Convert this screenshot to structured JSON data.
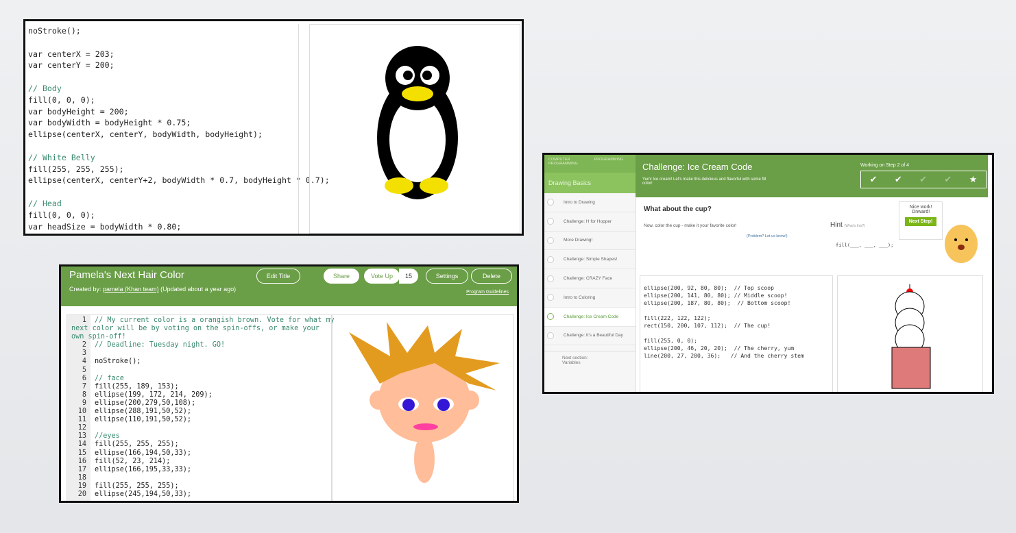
{
  "penguin_code": {
    "lines": [
      "noStroke();",
      "",
      "var centerX = 203;",
      "var centerY = 200;",
      "",
      "// Body",
      "fill(0, 0, 0);",
      "var bodyHeight = 200;",
      "var bodyWidth = bodyHeight * 0.75;",
      "ellipse(centerX, centerY, bodyWidth, bodyHeight);",
      "",
      "// White Belly",
      "fill(255, 255, 255);",
      "ellipse(centerX, centerY+2, bodyWidth * 0.7, bodyHeight * 0.7);",
      "",
      "// Head",
      "fill(0, 0, 0);",
      "var headSize = bodyWidth * 0.80;"
    ]
  },
  "hair": {
    "title": "Pamela's Next Hair Color",
    "edit_title": "Edit Title",
    "share": "Share",
    "vote_up": "Vote Up",
    "votes": "15",
    "settings": "Settings",
    "delete": "Delete",
    "created_by_label": "Created by:",
    "author": "pamela (Khan team)",
    "updated": "(Updated about a year ago)",
    "guidelines": "Program Guidelines",
    "lines": [
      "// My current color is a orangish brown. Vote for what my\nnext color will be by voting on the spin-offs, or make your\nown spin-off!",
      "// Deadline: Tuesday night. GO!",
      "",
      "noStroke();",
      "",
      "// face",
      "fill(255, 189, 153);",
      "ellipse(199, 172, 214, 209);",
      "ellipse(200,279,50,108);",
      "ellipse(288,191,50,52);",
      "ellipse(110,191,50,52);",
      "",
      "//eyes",
      "fill(255, 255, 255);",
      "ellipse(166,194,50,33);",
      "fill(52, 23, 214);",
      "ellipse(166,195,33,33);",
      "",
      "fill(255, 255, 255);",
      "ellipse(245,194,50,33);"
    ]
  },
  "ice": {
    "crumb1": "COMPUTER PROGRAMMING",
    "crumb2": "PROGRAMMING",
    "section": "Drawing Basics",
    "items": [
      "Intro to Drawing",
      "Challenge: H for Hopper",
      "More Drawing!",
      "Challenge: Simple Shapes!",
      "Challenge: CRAZY Face",
      "Intro to Coloring",
      "Challenge: Ice Cream Code",
      "Challenge: It's a Beautiful Day"
    ],
    "next_section": "Next section:",
    "next_name": "Variables",
    "title": "Challenge: Ice Cream Code",
    "desc": "Yum! Ice cream! Let's make this delicious and flavorful with some fill color!",
    "step": "Working on Step 2 of 4",
    "question": "What about the cup?",
    "instruction": "Now, color the cup - make it your favorite color!",
    "problem": "(Problem? Let us know!)",
    "hint": "Hint",
    "whats_this": "(What's this?)",
    "hint_code": "fill(___, ___, ___);",
    "nice": "Nice work!",
    "onward": "Onward!",
    "next_step": "Next Step!",
    "lines": [
      "ellipse(200, 92, 80, 80);  // Top scoop",
      "ellipse(200, 141, 80, 80); // Middle scoop!",
      "ellipse(200, 187, 80, 80);  // Bottom scoop!",
      "",
      "fill(222, 122, 122);",
      "rect(150, 200, 107, 112);  // The cup!",
      "",
      "fill(255, 0, 0);",
      "ellipse(200, 46, 20, 20);  // The cherry, yum",
      "line(200, 27, 200, 36);   // And the cherry stem"
    ]
  },
  "colors": {
    "green": "#6a9e47",
    "light_green": "#8cc35f"
  }
}
